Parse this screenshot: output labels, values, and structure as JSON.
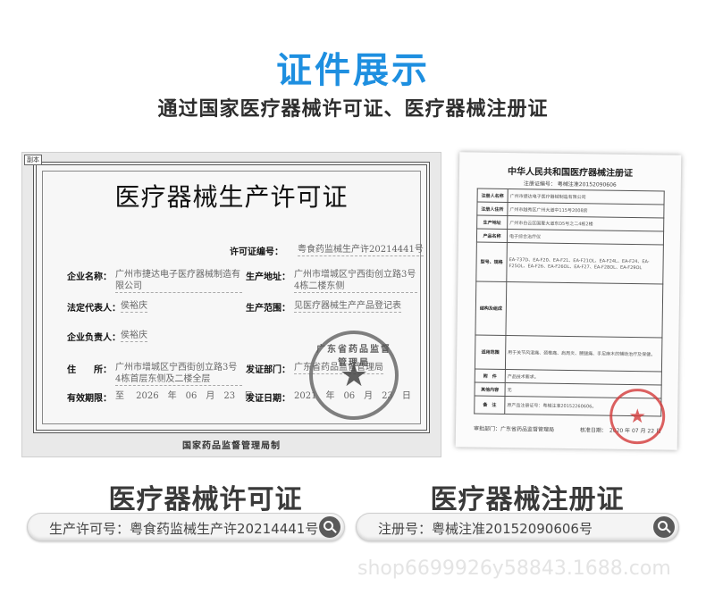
{
  "header": {
    "title": "证件展示",
    "title_color": "#1e8fe0",
    "subtitle": "通过国家医疗器械许可证、医疗器械注册证"
  },
  "license": {
    "corner_mark": "副本",
    "heading": "医疗器械生产许可证",
    "permit_label": "许可证编号：",
    "permit_value": "粤食药监械生产许20214441号",
    "company_label": "企业名称：",
    "company_value": "广州市捷达电子医疗器械制造有限公司",
    "address_label": "生产地址：",
    "address_value": "广州市增城区宁西街创立路3号4栋二楼东侧",
    "legal_label": "法定代表人：",
    "legal_value": "侯裕庆",
    "scope_label": "生产范围：",
    "scope_value": "见医疗器械生产产品登记表",
    "head_label": "企业负责人：",
    "head_value": "侯裕庆",
    "residence_label": "住　　所：",
    "residence_value": "广州市增城区宁西街创立路3号4栋首层东侧及二楼全层",
    "issuer_label": "发证部门：",
    "issuer_value": "广东省药品监督管理局",
    "valid_label": "有效期限：",
    "valid_value": "至　 2026　年　06　月　23　日",
    "date_label": "发证日期：",
    "date_value": "2021　年　06　月　23　日",
    "seal_text": "广东省药品监督管理局",
    "footer": "国家药品监督管理局制"
  },
  "registration": {
    "title": "中华人民共和国医疗器械注册证",
    "number_line": "注册证编号： 粤械注准20152090606",
    "rows": [
      {
        "k": "注册人名称",
        "v": "广州市捷达电子医疗器械制造有限公司"
      },
      {
        "k": "注册人住所",
        "v": "广州市越秀区广州大道中115号2008房"
      },
      {
        "k": "生产地址",
        "v": "广州市白云区国夏大道东D5号之二4栋2楼"
      },
      {
        "k": "产品名称",
        "v": "电子综合治疗仪"
      },
      {
        "k": "型号、规格",
        "v": "EA-737D、EA-F20、EA-F21、EA-F21OL、EA-F24L、EA-F24、EA-F25OL、EA-F26、EA-F26OL、EA-F27、EA-F28OL、EA-F29OL"
      },
      {
        "k": "结构及组成",
        "v": ""
      },
      {
        "k": "适用范围",
        "v": "用于关节风湿痛、颈椎痛、肩周炎、腰腿痛、手足麻木的辅助治疗及保健。"
      },
      {
        "k": "附　件",
        "v": "产品技术要求。"
      },
      {
        "k": "其他内容",
        "v": "无"
      },
      {
        "k": "备　注",
        "v": "原产品注册证号：粤械注准20152260606。"
      }
    ],
    "approval_dept": "审批部门：广东省药品监督管理局",
    "approval_date": "核准日期：　2020 年 07 月 22 日"
  },
  "captions": {
    "left": "医疗器械许可证",
    "right": "医疗器械注册证"
  },
  "pills": {
    "left": "生产许可号：粤食药监械生产许20214441号",
    "right": "注册号：粤械注准20152090606号"
  },
  "watermark": "shop6699926y58843.1688.com"
}
